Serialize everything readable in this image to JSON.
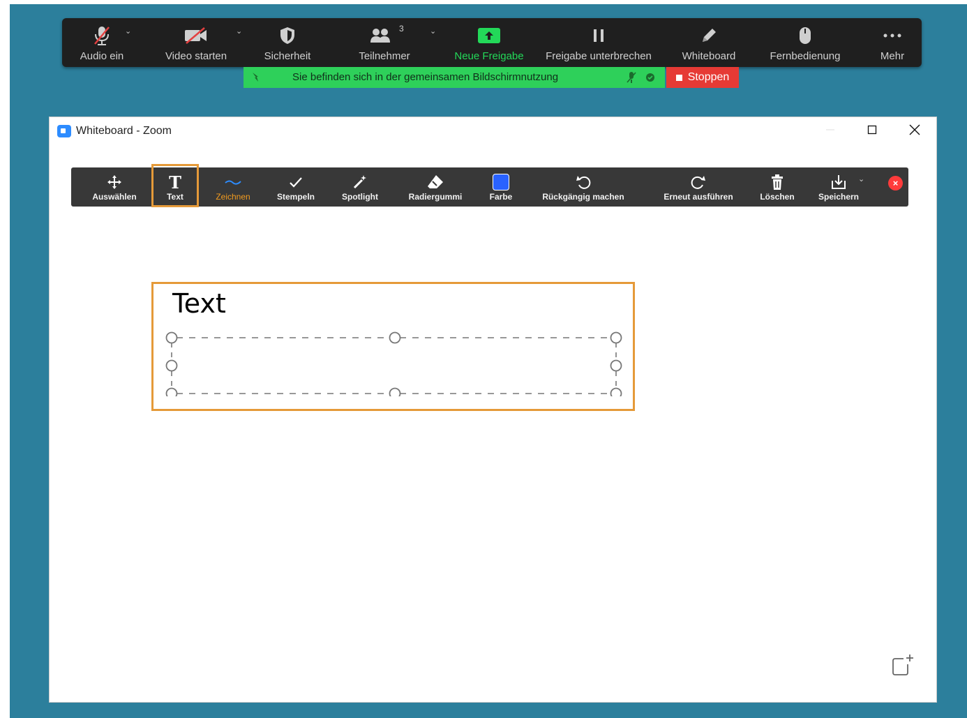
{
  "meeting_toolbar": {
    "items": [
      {
        "label": "Audio ein",
        "icon": "muted-microphone-icon"
      },
      {
        "label": "Video starten",
        "icon": "video-off-icon"
      },
      {
        "label": "Sicherheit",
        "icon": "shield-icon"
      },
      {
        "label": "Teilnehmer",
        "icon": "participants-icon",
        "count": "3"
      },
      {
        "label": "Neue Freigabe",
        "icon": "share-screen-icon"
      },
      {
        "label": "Freigabe unterbrechen",
        "icon": "pause-icon"
      },
      {
        "label": "Whiteboard",
        "icon": "pen-icon"
      },
      {
        "label": "Fernbedienung",
        "icon": "mouse-icon"
      },
      {
        "label": "Mehr",
        "icon": "more-icon"
      }
    ]
  },
  "share_banner": {
    "text": "Sie befinden sich in der gemeinsamen Bildschirmnutzung",
    "stop_label": "Stoppen"
  },
  "window": {
    "title": "Whiteboard - Zoom"
  },
  "whiteboard_toolbar": {
    "tools": [
      {
        "label": "Auswählen",
        "icon": "move-arrows-icon"
      },
      {
        "label": "Text",
        "icon": "text-t-icon",
        "selected": true
      },
      {
        "label": "Zeichnen",
        "icon": "squiggle-line-icon"
      },
      {
        "label": "Stempeln",
        "icon": "checkmark-icon"
      },
      {
        "label": "Spotlight",
        "icon": "magic-wand-icon"
      },
      {
        "label": "Radiergummi",
        "icon": "eraser-icon"
      },
      {
        "label": "Farbe",
        "icon": "color-swatch-icon",
        "color": "#2962ff"
      },
      {
        "label": "Rückgängig machen",
        "icon": "undo-icon"
      },
      {
        "label": "Erneut ausführen",
        "icon": "redo-icon"
      },
      {
        "label": "Löschen",
        "icon": "trash-icon"
      },
      {
        "label": "Speichern",
        "icon": "save-download-icon"
      }
    ]
  },
  "canvas": {
    "text_object": "Text"
  },
  "colors": {
    "accent_orange": "#e59a39",
    "share_green": "#2ed05a",
    "stop_red": "#e63a35",
    "desktop_blue": "#2c7f9c"
  }
}
